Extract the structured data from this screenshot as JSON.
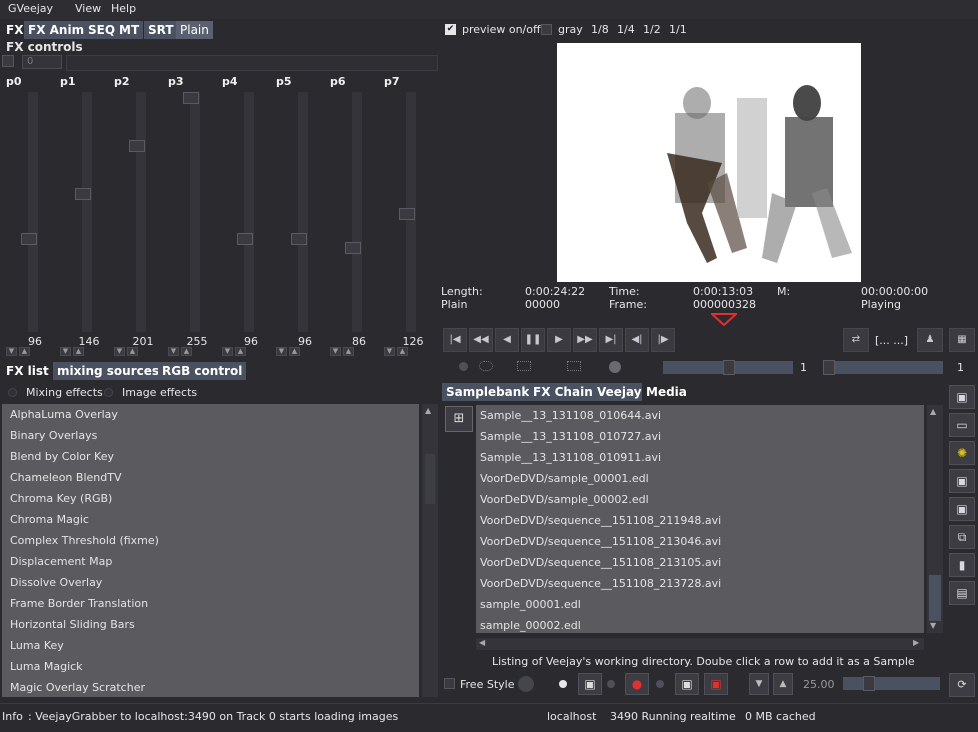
{
  "menu": {
    "gveejay": "GVeejay",
    "view": "View",
    "help": "Help"
  },
  "top_tabs": [
    "FX",
    "FX Anim",
    "SEQ",
    "MT",
    "SRT",
    "Plain"
  ],
  "fx_controls": {
    "title": "FX controls",
    "spin_value": "0",
    "params": [
      {
        "label": "p0",
        "value": "96",
        "level": 0.38
      },
      {
        "label": "p1",
        "value": "146",
        "level": 0.58
      },
      {
        "label": "p2",
        "value": "201",
        "level": 0.79
      },
      {
        "label": "p3",
        "value": "255",
        "level": 1.0
      },
      {
        "label": "p4",
        "value": "96",
        "level": 0.38
      },
      {
        "label": "p5",
        "value": "96",
        "level": 0.38
      },
      {
        "label": "p6",
        "value": "86",
        "level": 0.34
      },
      {
        "label": "p7",
        "value": "126",
        "level": 0.49
      }
    ]
  },
  "fx_tabs": [
    "FX list",
    "mixing sources",
    "RGB control"
  ],
  "effect_types": {
    "mixing": "Mixing effects",
    "image": "Image effects"
  },
  "fx_list": [
    "AlphaLuma Overlay",
    "Binary Overlays",
    "Blend by Color Key",
    "Chameleon BlendTV",
    "Chroma Key (RGB)",
    "Chroma Magic",
    "Complex Threshold (fixme)",
    "Displacement Map",
    "Dissolve Overlay",
    "Frame Border Translation",
    "Horizontal Sliding Bars",
    "Luma Key",
    "Luma Magick",
    "Magic Overlay Scratcher"
  ],
  "preview": {
    "toggle_label": "preview on/off",
    "gray_label": "gray",
    "scales": [
      "1/8",
      "1/4",
      "1/2",
      "1/1"
    ]
  },
  "timecode": {
    "length_label": "Length:",
    "length_value": "0:00:24:22",
    "time_label": "Time:",
    "time_value": "0:00:13:03",
    "m_label": "M:",
    "m_value": "00:00:00:00",
    "mode": "Plain",
    "frames": "00000",
    "frame_label": "Frame:",
    "frame_value": "000000328",
    "state": "Playing"
  },
  "transport": {
    "buttons": [
      "goto-start",
      "fast-rewind",
      "reverse",
      "pause",
      "play",
      "fast-forward",
      "goto-end",
      "prev-frame",
      "next-frame"
    ],
    "bracket_label": "[... ...]",
    "speed_value": "1",
    "slow_value": "1"
  },
  "sample_tabs": [
    "Samplebank",
    "FX Chain",
    "Veejay",
    "Media"
  ],
  "media_list": [
    "Sample__13_131108_010644.avi",
    "Sample__13_131108_010727.avi",
    "Sample__13_131108_010911.avi",
    "VoorDeDVD/sample_00001.edl",
    "VoorDeDVD/sample_00002.edl",
    "VoorDeDVD/sequence__151108_211948.avi",
    "VoorDeDVD/sequence__151108_213046.avi",
    "VoorDeDVD/sequence__151108_213105.avi",
    "VoorDeDVD/sequence__151108_213728.avi",
    "sample_00001.edl",
    "sample_00002.edl"
  ],
  "media_hint": "Listing of Veejay's working directory. Doube click a row to add it as a Sample",
  "bottom_controls": {
    "free_style": "Free Style",
    "fps": "25.00"
  },
  "status": {
    "info_label": "Info",
    "message": ": VeejayGrabber to localhost:3490 on Track 0 starts loading images",
    "host": "localhost",
    "port_state": "3490 Running realtime",
    "cache": "0 MB cached"
  },
  "colors": {
    "tab_inactive": "#4a5262",
    "list_bg": "#5b5b5f",
    "panel_bg": "#2b2b2f",
    "marker_red": "#e03030"
  }
}
